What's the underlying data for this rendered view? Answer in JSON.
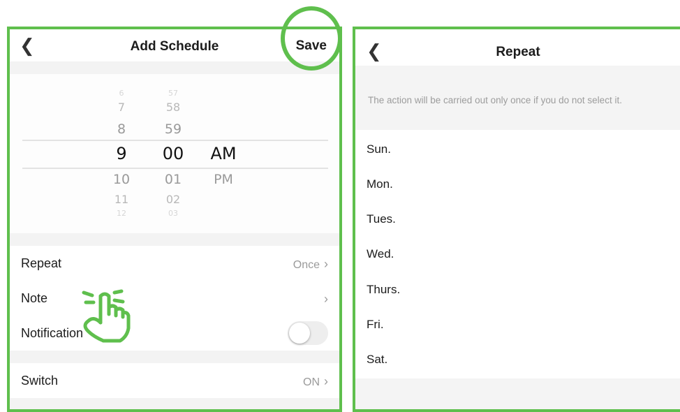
{
  "colors": {
    "highlight_green": "#5fbf4d",
    "section_gray": "#f3f3f3",
    "secondary_text": "#9a9a9a"
  },
  "add_schedule": {
    "back_icon": "chevron-left-icon",
    "title": "Add Schedule",
    "save_label": "Save",
    "picker": {
      "hour": {
        "above": [
          "6",
          "7",
          "8"
        ],
        "selected": "9",
        "below": [
          "10",
          "11",
          "12"
        ]
      },
      "minute": {
        "above": [
          "57",
          "58",
          "59"
        ],
        "selected": "00",
        "below": [
          "01",
          "02",
          "03"
        ]
      },
      "period": {
        "selected": "AM",
        "below": [
          "PM"
        ]
      }
    },
    "rows": {
      "repeat": {
        "label": "Repeat",
        "value": "Once"
      },
      "note": {
        "label": "Note",
        "value": ""
      },
      "notification": {
        "label": "Notification",
        "enabled": false
      },
      "switch": {
        "label": "Switch",
        "value": "ON"
      }
    },
    "chevron_icon": "chevron-right-icon",
    "annotation_icon": "tap-hand-icon"
  },
  "repeat_screen": {
    "back_icon": "chevron-left-icon",
    "title": "Repeat",
    "hint": "The action will be carried out only once if you do not select it.",
    "days": [
      "Sun.",
      "Mon.",
      "Tues.",
      "Wed.",
      "Thurs.",
      "Fri.",
      "Sat."
    ]
  }
}
